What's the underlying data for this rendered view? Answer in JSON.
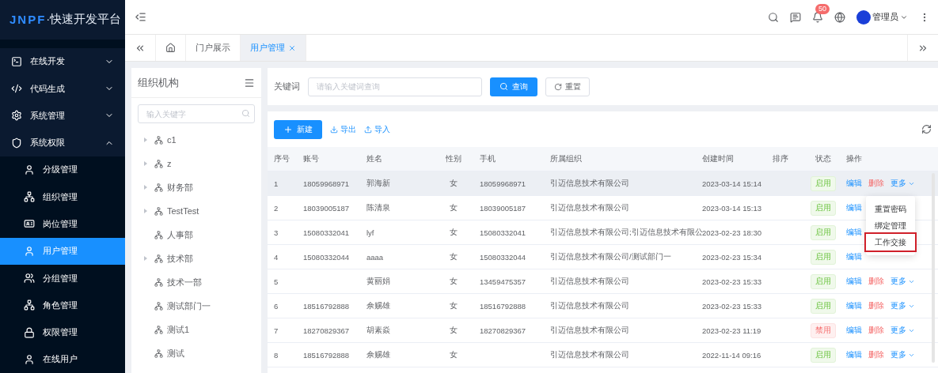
{
  "logo": {
    "brand": "JNPF",
    "title": "·快速开发平台"
  },
  "header": {
    "notification_count": "50",
    "user": "管理员"
  },
  "sidebar": {
    "items": [
      {
        "label": "在线开发",
        "expanded": false
      },
      {
        "label": "代码生成",
        "expanded": false
      },
      {
        "label": "系统管理",
        "expanded": false
      },
      {
        "label": "系统权限",
        "expanded": true,
        "children": [
          {
            "label": "分级管理",
            "selected": false
          },
          {
            "label": "组织管理",
            "selected": false
          },
          {
            "label": "岗位管理",
            "selected": false
          },
          {
            "label": "用户管理",
            "selected": true
          },
          {
            "label": "分组管理",
            "selected": false
          },
          {
            "label": "角色管理",
            "selected": false
          },
          {
            "label": "权限管理",
            "selected": false
          },
          {
            "label": "在线用户",
            "selected": false
          }
        ]
      }
    ]
  },
  "tabs": [
    {
      "label": "门户展示",
      "selected": false,
      "closable": false
    },
    {
      "label": "用户管理",
      "selected": true,
      "closable": true
    }
  ],
  "org_panel": {
    "title": "组织机构",
    "search_placeholder": "输入关键字",
    "tree": [
      {
        "label": "c1",
        "has_children": true
      },
      {
        "label": "z",
        "has_children": true
      },
      {
        "label": "财务部",
        "has_children": true
      },
      {
        "label": "TestTest",
        "has_children": true
      },
      {
        "label": "人事部",
        "has_children": false
      },
      {
        "label": "技术部",
        "has_children": true
      },
      {
        "label": "技术一部",
        "has_children": false
      },
      {
        "label": "测试部门一",
        "has_children": false
      },
      {
        "label": "测试1",
        "has_children": false
      },
      {
        "label": "测试",
        "has_children": false
      }
    ]
  },
  "search": {
    "label": "关键词",
    "placeholder": "请输入关键词查询",
    "query_button": "查询",
    "reset_button": "重置"
  },
  "toolbar": {
    "new_button": "新建",
    "export": "导出",
    "import": "导入"
  },
  "table": {
    "columns": [
      "序号",
      "账号",
      "姓名",
      "性别",
      "手机",
      "所属组织",
      "创建时间",
      "排序",
      "状态",
      "操作"
    ],
    "rows": [
      {
        "index": "1",
        "account": "18059968971",
        "name": "郭海新",
        "gender": "女",
        "phone": "18059968971",
        "org": "引迈信息技术有限公司",
        "created": "2023-03-14 15:14",
        "status": "启用",
        "enabled": true,
        "selected": true,
        "actions": [
          "编辑",
          "删除",
          "更多"
        ]
      },
      {
        "index": "2",
        "account": "18039005187",
        "name": "陈清泉",
        "gender": "女",
        "phone": "18039005187",
        "org": "引迈信息技术有限公司",
        "created": "2023-03-14 15:13",
        "status": "启用",
        "enabled": true,
        "selected": false,
        "actions": [
          "编辑"
        ]
      },
      {
        "index": "3",
        "account": "15080332041",
        "name": "lyf",
        "gender": "女",
        "phone": "15080332041",
        "org": "引迈信息技术有限公司;引迈信息技术有限公",
        "created": "2023-02-23 18:30",
        "status": "启用",
        "enabled": true,
        "selected": false,
        "actions": [
          "编辑"
        ]
      },
      {
        "index": "4",
        "account": "15080332044",
        "name": "aaaa",
        "gender": "女",
        "phone": "15080332044",
        "org": "引迈信息技术有限公司/测试部门一",
        "created": "2023-02-23 15:34",
        "status": "启用",
        "enabled": true,
        "selected": false,
        "actions": [
          "编辑"
        ]
      },
      {
        "index": "5",
        "account": "",
        "name": "黄丽娟",
        "gender": "女",
        "phone": "13459475357",
        "org": "引迈信息技术有限公司",
        "created": "2023-02-23 15:33",
        "status": "启用",
        "enabled": true,
        "selected": false,
        "actions": [
          "编辑",
          "删除",
          "更多"
        ]
      },
      {
        "index": "6",
        "account": "18516792888",
        "name": "佘赐雄",
        "gender": "女",
        "phone": "18516792888",
        "org": "引迈信息技术有限公司",
        "created": "2023-02-23 15:33",
        "status": "启用",
        "enabled": true,
        "selected": false,
        "actions": [
          "编辑",
          "删除",
          "更多"
        ]
      },
      {
        "index": "7",
        "account": "18270829367",
        "name": "胡素焱",
        "gender": "女",
        "phone": "18270829367",
        "org": "引迈信息技术有限公司",
        "created": "2023-02-23 11:19",
        "status": "禁用",
        "enabled": false,
        "selected": false,
        "actions": [
          "编辑",
          "删除",
          "更多"
        ]
      },
      {
        "index": "8",
        "account": "18516792888",
        "name": "佘赐雄",
        "gender": "女",
        "phone": "",
        "org": "引迈信息技术有限公司",
        "created": "2022-11-14 09:16",
        "status": "启用",
        "enabled": true,
        "selected": false,
        "actions": [
          "编辑",
          "删除",
          "更多"
        ]
      }
    ]
  },
  "dropdown": {
    "items": [
      {
        "label": "重置密码",
        "highlighted": false
      },
      {
        "label": "绑定管理",
        "highlighted": false
      },
      {
        "label": "工作交接",
        "highlighted": true
      }
    ]
  }
}
